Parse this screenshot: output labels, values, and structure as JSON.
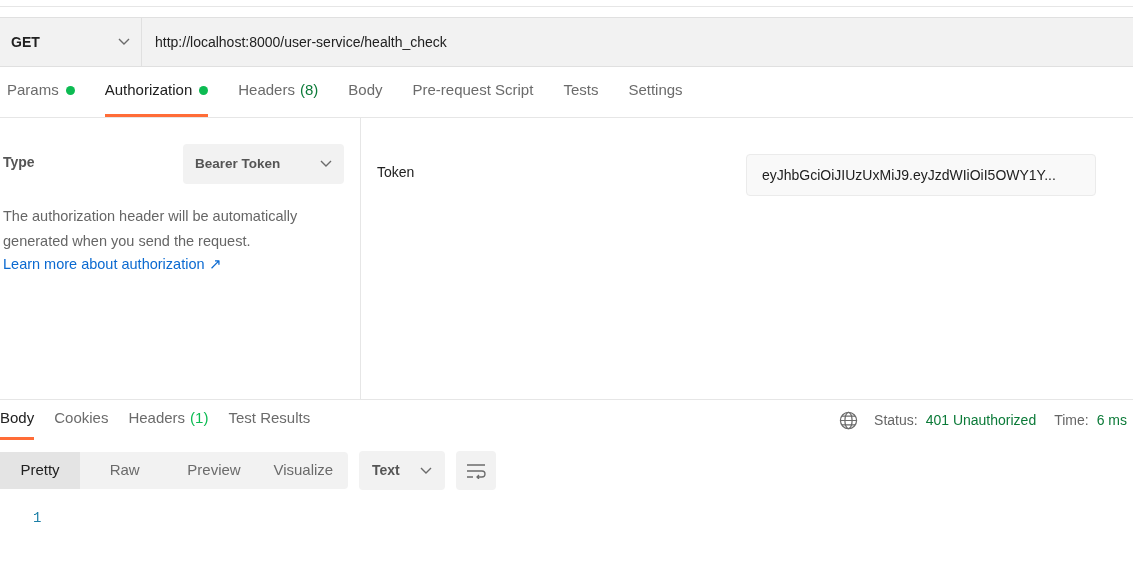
{
  "request": {
    "method": "GET",
    "url": "http://localhost:8000/user-service/health_check"
  },
  "request_tabs": [
    {
      "label": "Params",
      "indicator": true,
      "selected": false
    },
    {
      "label": "Authorization",
      "indicator": true,
      "selected": true
    },
    {
      "label": "Headers",
      "count": "(8)",
      "indicator": false,
      "selected": false
    },
    {
      "label": "Body",
      "indicator": false,
      "selected": false
    },
    {
      "label": "Pre-request Script",
      "indicator": false,
      "selected": false
    },
    {
      "label": "Tests",
      "indicator": false,
      "selected": false
    },
    {
      "label": "Settings",
      "indicator": false,
      "selected": false
    }
  ],
  "authorization": {
    "type_label": "Type",
    "type_value": "Bearer Token",
    "description": "The authorization header will be automatically generated when you send the request.",
    "learn_more_link": "Learn more about authorization ↗",
    "token_label": "Token",
    "token_value": "eyJhbGciOiJIUzUxMiJ9.eyJzdWIiOiI5OWY1Y..."
  },
  "response_tabs": [
    {
      "label": "Body",
      "selected": true
    },
    {
      "label": "Cookies",
      "selected": false
    },
    {
      "label": "Headers",
      "count": "(1)",
      "selected": false
    },
    {
      "label": "Test Results",
      "selected": false
    }
  ],
  "status_bar": {
    "status_label": "Status:",
    "status_value": "401 Unauthorized",
    "time_label": "Time:",
    "time_value": "6 ms"
  },
  "view_modes": [
    {
      "label": "Pretty",
      "selected": true
    },
    {
      "label": "Raw",
      "selected": false
    },
    {
      "label": "Preview",
      "selected": false
    },
    {
      "label": "Visualize",
      "selected": false
    }
  ],
  "format": "Text",
  "line_numbers": [
    "1"
  ]
}
